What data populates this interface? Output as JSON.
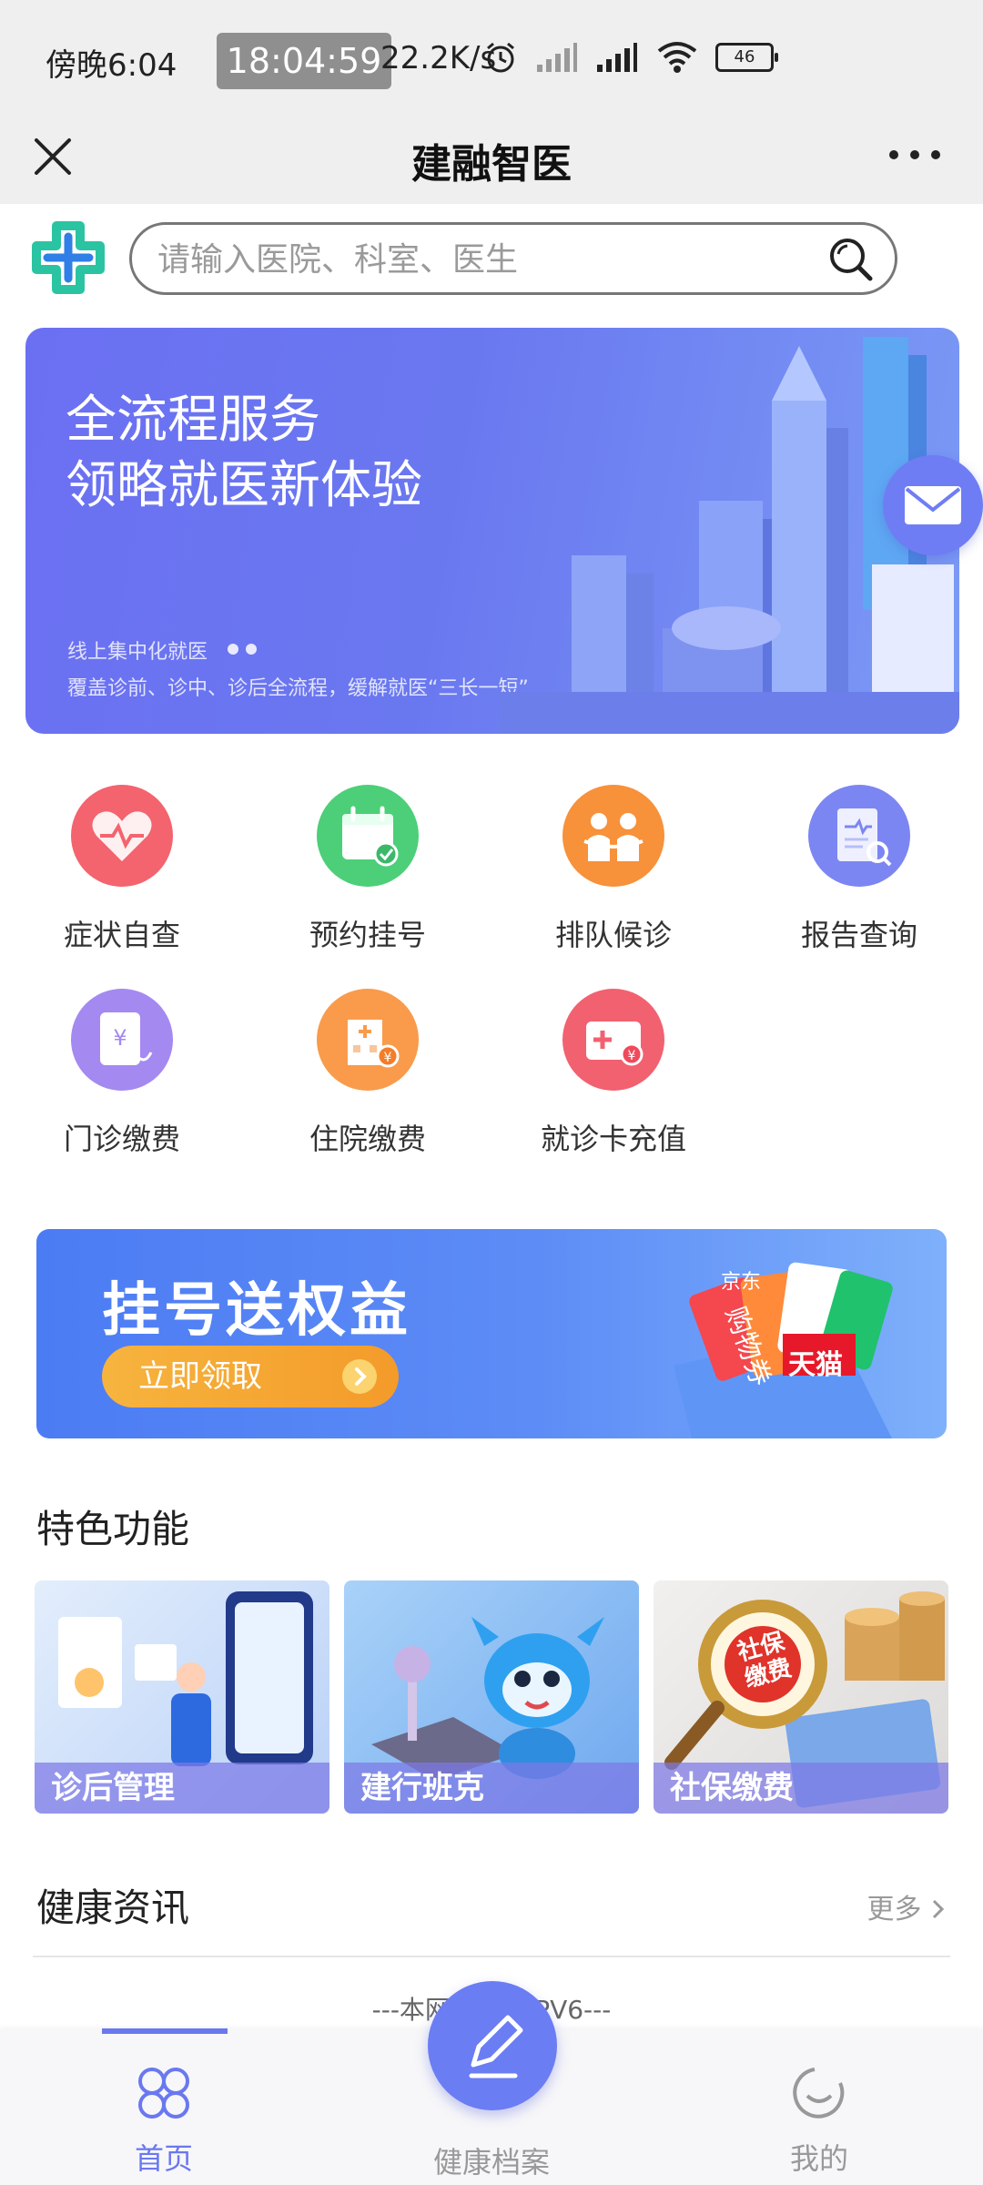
{
  "status_bar": {
    "time": "傍晚6:04",
    "clock_overlay": "18:04:59",
    "network_speed": "22.2K/s",
    "battery": "46"
  },
  "title_bar": {
    "title": "建融智医"
  },
  "search": {
    "placeholder": "请输入医院、科室、医生"
  },
  "banner": {
    "line1": "全流程服务",
    "line2": "领略就医新体验",
    "small1": "线上集中化就医",
    "small2": "覆盖诊前、诊中、诊后全流程，缓解就医“三长一短”"
  },
  "services": [
    {
      "label": "症状自查",
      "icon": "heart-pulse-icon",
      "color": "#f3646e"
    },
    {
      "label": "预约挂号",
      "icon": "calendar-check-icon",
      "color": "#4ccf78"
    },
    {
      "label": "排队候诊",
      "icon": "queue-icon",
      "color": "#f7913a"
    },
    {
      "label": "报告查询",
      "icon": "report-search-icon",
      "color": "#7c86f2"
    },
    {
      "label": "门诊缴费",
      "icon": "outpatient-fee-icon",
      "color": "#a489f1"
    },
    {
      "label": "住院缴费",
      "icon": "hospital-fee-icon",
      "color": "#f99b4b"
    },
    {
      "label": "就诊卡充值",
      "icon": "card-topup-icon",
      "color": "#f26170"
    }
  ],
  "promo": {
    "title": "挂号送权益",
    "button": "立即领取",
    "tags": [
      "京东",
      "购物券",
      "天猫"
    ]
  },
  "features": {
    "title": "特色功能",
    "items": [
      {
        "label": "诊后管理"
      },
      {
        "label": "建行班克"
      },
      {
        "label": "社保缴费"
      }
    ],
    "stamp_text": "社保缴费"
  },
  "news": {
    "title": "健康资讯",
    "more": "更多",
    "footer": "---本网站支持IPV6---"
  },
  "bottom_nav": {
    "home": "首页",
    "health_record": "健康档案",
    "mine": "我的"
  },
  "colors": {
    "accent": "#6a78f0",
    "background": "#ffffff",
    "bar": "#efefef"
  }
}
